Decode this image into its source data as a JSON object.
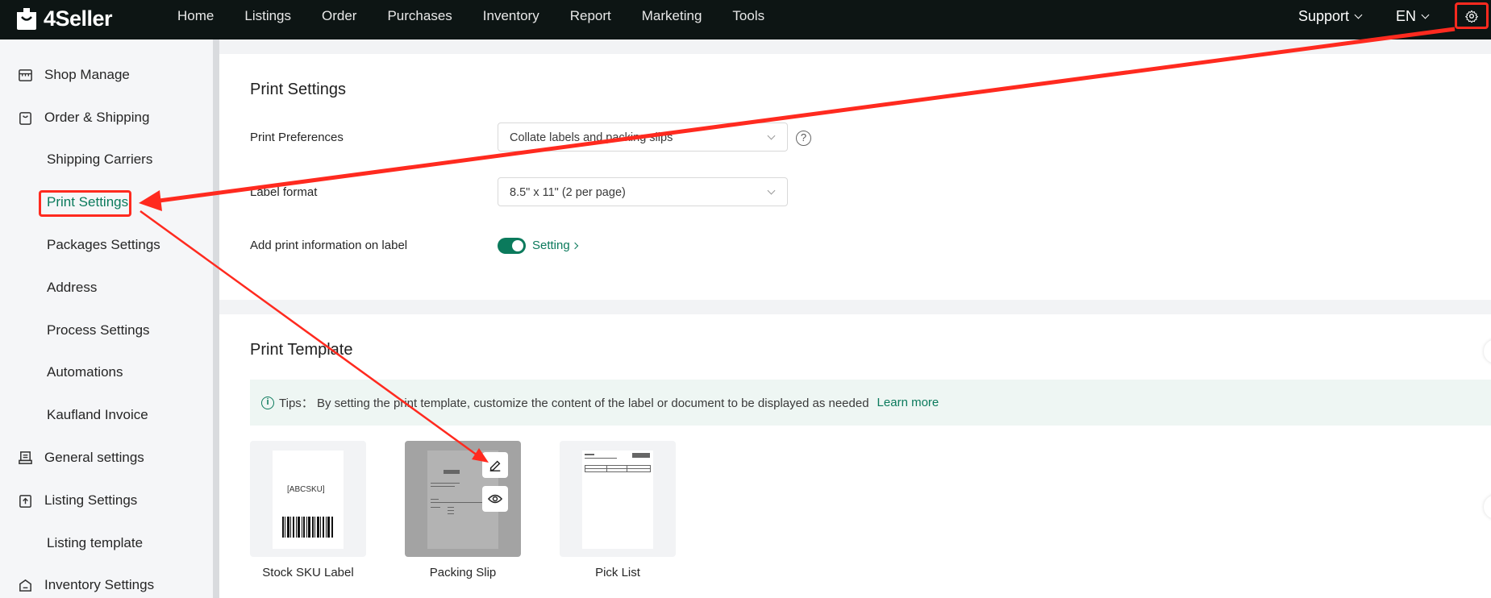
{
  "brand": {
    "name": "4Seller"
  },
  "nav": {
    "items": [
      "Home",
      "Listings",
      "Order",
      "Purchases",
      "Inventory",
      "Report",
      "Marketing",
      "Tools"
    ]
  },
  "topbar": {
    "support": "Support",
    "language": "EN"
  },
  "sidebar": {
    "shop_manage": "Shop Manage",
    "order_shipping": "Order & Shipping",
    "shipping_carriers": "Shipping Carriers",
    "print_settings": "Print Settings",
    "packages_settings": "Packages Settings",
    "address": "Address",
    "process_settings": "Process Settings",
    "automations": "Automations",
    "kaufland_invoice": "Kaufland Invoice",
    "general_settings": "General settings",
    "listing_settings": "Listing Settings",
    "listing_template": "Listing template",
    "inventory_settings": "Inventory Settings"
  },
  "print_settings": {
    "title": "Print Settings",
    "preferences_label": "Print Preferences",
    "preferences_value": "Collate labels and packing slips",
    "label_format_label": "Label format",
    "label_format_value": "8.5\" x 11\" (2 per page)",
    "add_info_label": "Add print information on label",
    "add_info_enabled": true,
    "setting_link": "Setting"
  },
  "print_template": {
    "title": "Print Template",
    "tips": "Tips： By setting the print template, customize the content of the label or document to be displayed as needed",
    "learn_more": "Learn more",
    "templates": [
      {
        "name": "Stock SKU Label",
        "barcode_text": "[ABCSKU]"
      },
      {
        "name": "Packing Slip"
      },
      {
        "name": "Pick List"
      }
    ]
  },
  "colors": {
    "accent": "#0b7a5c",
    "topbar": "#0d1514",
    "annotation": "#ff2a1f"
  },
  "icons": [
    "logo-bag-icon",
    "settings-gear-icon",
    "shop-icon",
    "cart-icon",
    "printer-icon",
    "listing-icon",
    "inventory-icon",
    "edit-icon",
    "eye-icon",
    "info-icon",
    "help-icon"
  ]
}
